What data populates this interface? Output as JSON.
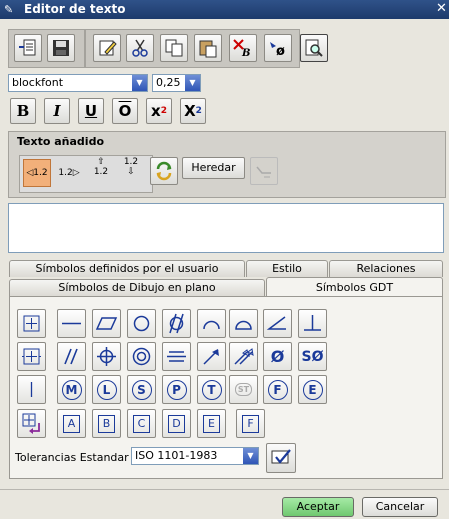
{
  "window": {
    "title": "Editor de texto",
    "icon": "pencil-arrow-icon",
    "close": "✕"
  },
  "font": {
    "family": "blockfont",
    "size": "0,25"
  },
  "format_buttons": [
    {
      "name": "bold-button",
      "label": "B"
    },
    {
      "name": "italic-button",
      "label": "I"
    },
    {
      "name": "underline-button",
      "label": "U"
    },
    {
      "name": "overline-button",
      "label": "O"
    },
    {
      "name": "superscript-button",
      "label": "x",
      "sub": "2"
    },
    {
      "name": "subscript-button",
      "label": "X",
      "sub": "2"
    }
  ],
  "added_text": {
    "heading": "Texto añadido",
    "options": [
      "1.2",
      "1.2",
      "1.2",
      "1.2"
    ],
    "inherit_label": "Heredar"
  },
  "tabs": {
    "row1": [
      "Símbolos definidos por el usuario",
      "Estilo",
      "Relaciones"
    ],
    "row2": [
      "Símbolos de Dibujo en plano",
      "Símbolos GDT"
    ],
    "active": "Símbolos GDT"
  },
  "datum_letters": [
    "A",
    "B",
    "C",
    "D",
    "E",
    "F"
  ],
  "gdt_text_symbols": [
    "Ø",
    "SØ"
  ],
  "modifier_letters": [
    "M",
    "L",
    "S",
    "P",
    "T",
    "ST",
    "F",
    "E"
  ],
  "tolerance": {
    "label": "Tolerancias Estandar",
    "value": "ISO 1101-1983"
  },
  "footer": {
    "ok": "Aceptar",
    "cancel": "Cancelar"
  },
  "colors": {
    "title_bar": "#1d3a6b",
    "ok_button": "#7fd67f",
    "symbol_blue": "#1b3a9a",
    "active_option": "#f2b07a"
  }
}
